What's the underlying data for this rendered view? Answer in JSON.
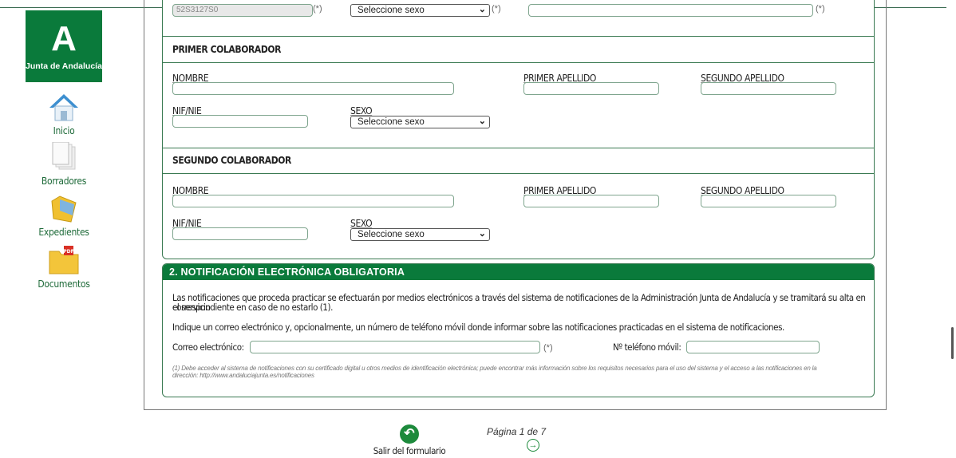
{
  "sidebar": {
    "logo_mark": "A",
    "logo_text": "Junta de Andalucía",
    "items": [
      {
        "label": "Inicio",
        "icon": "home-icon"
      },
      {
        "label": "Borradores",
        "icon": "drafts-icon"
      },
      {
        "label": "Expedientes",
        "icon": "folder-icon"
      },
      {
        "label": "Documentos",
        "icon": "pdf-folder-icon"
      }
    ]
  },
  "top_row": {
    "nif_value": "52S3127S0",
    "sexo_placeholder": "Seleccione sexo",
    "req_marker": "(*)"
  },
  "primer_colaborador": {
    "title": "PRIMER COLABORADOR",
    "nombre": "NOMBRE",
    "primer_apellido": "PRIMER APELLIDO",
    "segundo_apellido": "SEGUNDO APELLIDO",
    "nif": "NIF/NIE",
    "sexo": "SEXO",
    "sexo_value": "Seleccione sexo"
  },
  "segundo_colaborador": {
    "title": "SEGUNDO COLABORADOR",
    "nombre": "NOMBRE",
    "primer_apellido": "PRIMER APELLIDO",
    "segundo_apellido": "SEGUNDO APELLIDO",
    "nif": "NIF/NIE",
    "sexo": "SEXO",
    "sexo_value": "Seleccione sexo"
  },
  "notificacion": {
    "title": "2. NOTIFICACIÓN ELECTRÓNICA OBLIGATORIA",
    "para1_line1": "Las notificaciones que proceda practicar se efectuarán por medios electrónicos a través del sistema de notificaciones de la Administración Junta de Andalucía y se tramitará su alta en el servicio",
    "para1_line2": "correspondiente en caso de no estarlo (1).",
    "para2": "Indique un correo electrónico y, opcionalmente, un número de teléfono móvil donde informar sobre las notificaciones practicadas en el sistema de notificaciones.",
    "email_label": "Correo electrónico:",
    "email_req": "(*)",
    "phone_label": "Nº teléfono móvil:",
    "footnote_line1": "(1) Debe acceder al sistema de notificaciones con su certificado digital u otros medios de identificación electrónica; puede encontrar más información sobre los requisitos necesarios para el uso del sistema y el acceso a las notificaciones en la",
    "footnote_line2": "dirección: http://www.andaluciajunta.es/notificaciones"
  },
  "footer": {
    "exit_label": "Salir del formulario",
    "page_indicator": "Página 1 de 7"
  },
  "colors": {
    "brand_green": "#0a7a3b",
    "border_green": "#3a7a52"
  }
}
